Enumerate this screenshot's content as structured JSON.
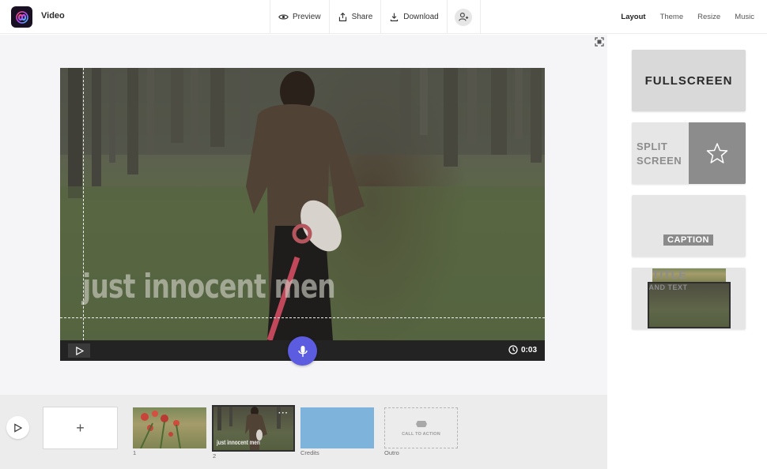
{
  "app": {
    "title": "Video"
  },
  "toolbar": {
    "preview_label": "Preview",
    "share_label": "Share",
    "download_label": "Download"
  },
  "right_tabs": [
    {
      "label": "Layout",
      "active": true
    },
    {
      "label": "Theme",
      "active": false
    },
    {
      "label": "Resize",
      "active": false
    },
    {
      "label": "Music",
      "active": false
    }
  ],
  "video": {
    "caption": "just innocent men",
    "duration": "0:03"
  },
  "layouts": {
    "fullscreen": "FULLSCREEN",
    "split_line1": "SPLIT",
    "split_line2": "SCREEN",
    "caption": "CAPTION",
    "title_line1": "TITLE",
    "title_line2": "AND TEXT"
  },
  "timeline": {
    "add_label": "+",
    "slides": [
      {
        "label": "1"
      },
      {
        "label": "2",
        "caption": "just innocent men",
        "menu": "···"
      },
      {
        "label": "Credits"
      },
      {
        "label": "Outro",
        "placeholder": "CALL TO ACTION"
      }
    ]
  },
  "colors": {
    "accent": "#5c5ce0",
    "credits_slide": "#7eb4dc"
  }
}
